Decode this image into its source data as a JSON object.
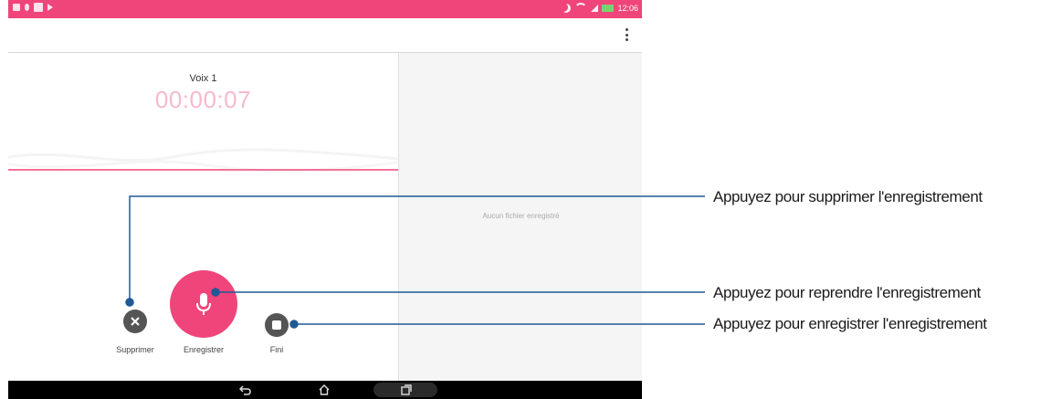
{
  "app": {
    "recording_name": "Voix 1",
    "timer": "00:00:07",
    "empty_message": "Aucun fichier enregistré"
  },
  "status_bar": {
    "time": "12:06"
  },
  "controls": {
    "delete_label": "Supprimer",
    "record_label": "Enregistrer",
    "done_label": "Fini"
  },
  "callouts": [
    {
      "text": "Appuyez pour supprimer l'enregistrement"
    },
    {
      "text": "Appuyez pour reprendre l'enregistrement"
    },
    {
      "text": "Appuyez pour enregistrer l'enregistrement"
    }
  ],
  "colors": {
    "accent": "#f0457a",
    "timer": "#f7b9cc",
    "callout_line": "#1f5a96"
  },
  "icons": [
    "overflow-menu-icon",
    "close-icon",
    "microphone-icon",
    "stop-icon",
    "back-icon",
    "home-icon",
    "recent-apps-icon"
  ]
}
